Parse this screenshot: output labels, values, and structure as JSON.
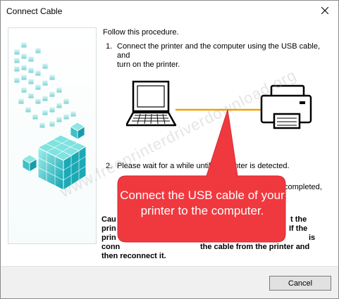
{
  "window": {
    "title": "Connect Cable"
  },
  "instructions": {
    "intro": "Follow this procedure.",
    "step1_number": "1.",
    "step1_line1": "Connect the printer and the computer using the USB cable, and",
    "step1_line2": "turn on the printer.",
    "step2_number": "2.",
    "step2_text": "Please wait for a while until the printer is detected.",
    "completed_line1": "completed,",
    "completed_line2": "t",
    "caution_lines": [
      "Cau",
      "prin",
      "prin",
      "conn"
    ],
    "caution_right_lines": [
      "t the",
      "If the",
      "is"
    ],
    "caution_tail1": "the cable from the printer and",
    "caution_tail2": "then reconnect it."
  },
  "callout": {
    "text": "Connect the USB cable of your printer to the computer.",
    "color": "#f0393f"
  },
  "diagram": {
    "left_icon": "laptop-icon",
    "right_icon": "printer-icon",
    "cable_color": "#f5a000"
  },
  "watermark": {
    "text": "www.freeprinterdriverdownload.org"
  },
  "footer": {
    "cancel_label": "Cancel"
  }
}
